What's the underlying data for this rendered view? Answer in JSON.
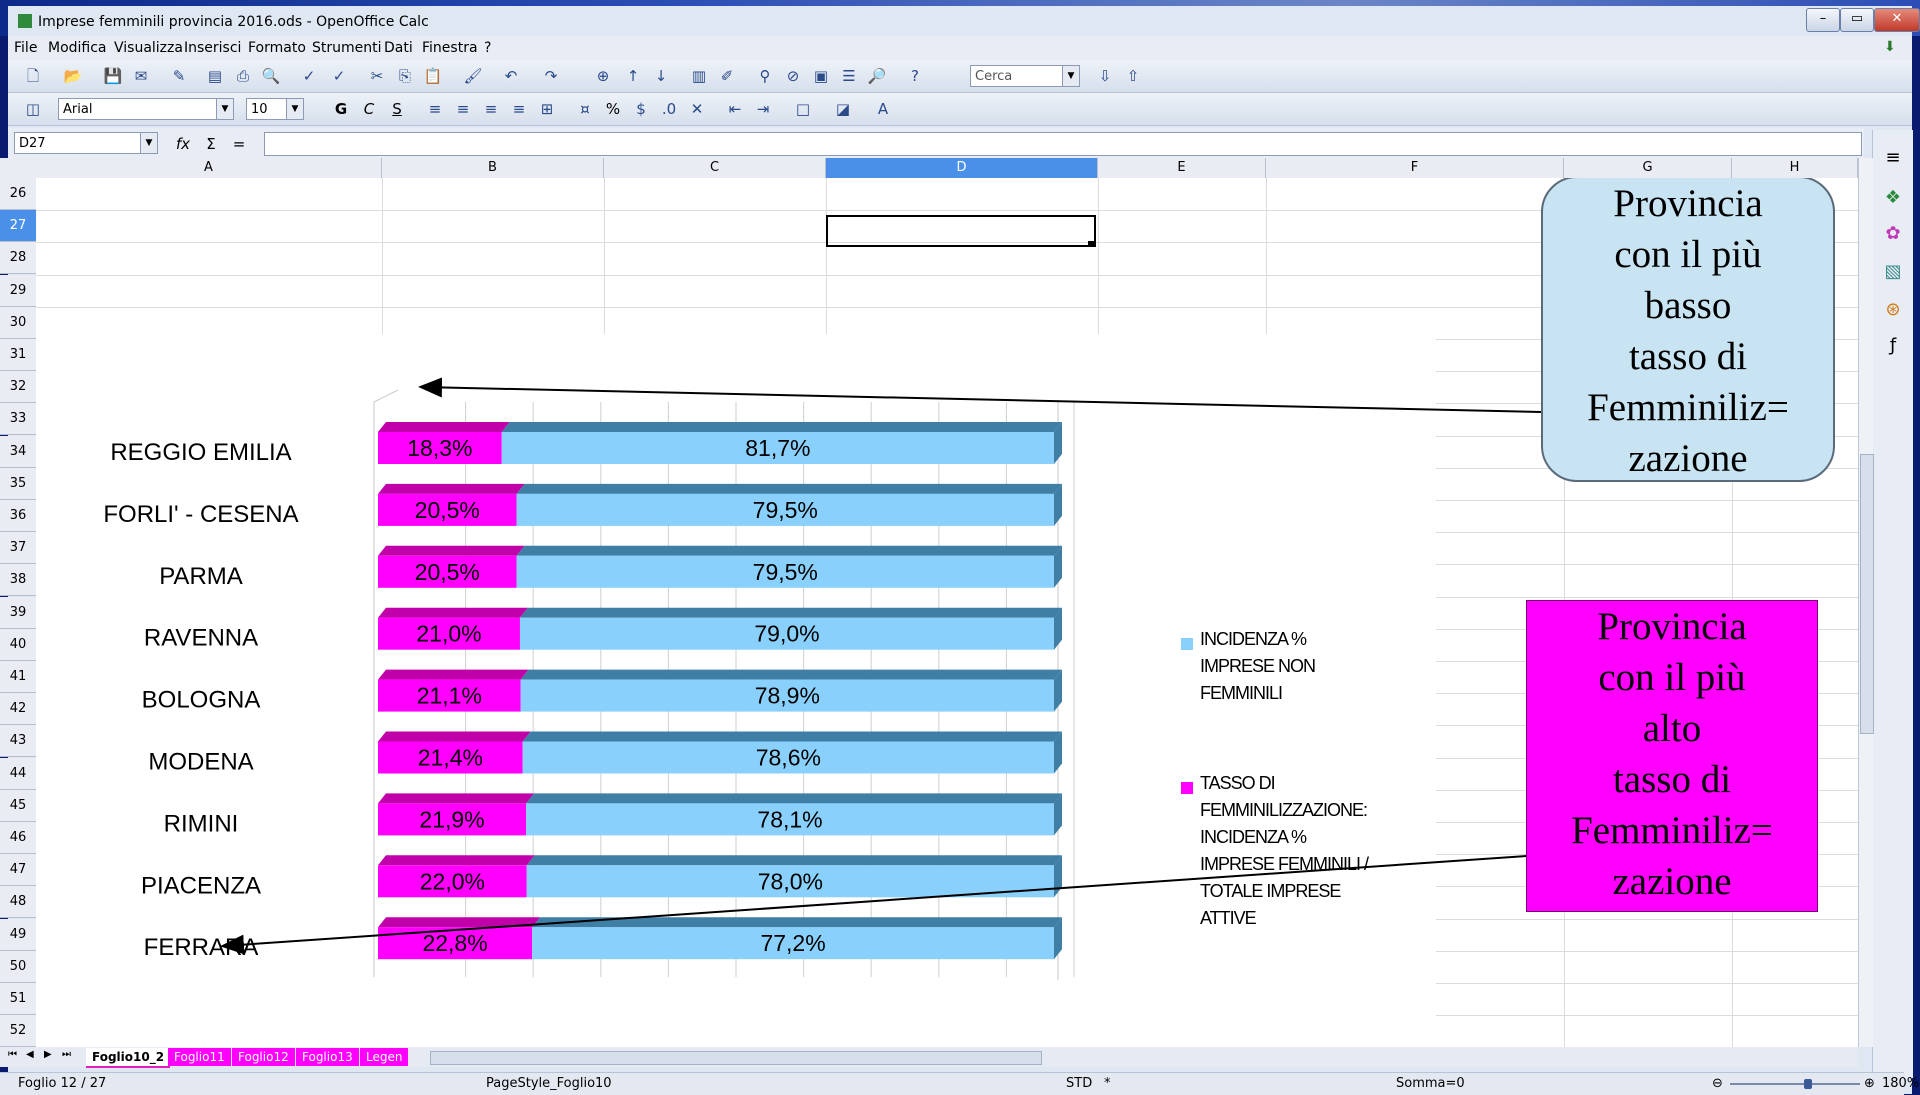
{
  "window": {
    "title": "Imprese femminili provincia 2016.ods - OpenOffice Calc",
    "buttons": {
      "minimize": "–",
      "maximize": "▭",
      "close": "✕"
    }
  },
  "menu": [
    "File",
    "Modifica",
    "Visualizza",
    "Inserisci",
    "Formato",
    "Strumenti",
    "Dati",
    "Finestra",
    "?"
  ],
  "toolbar": {
    "search_placeholder": "Cerca",
    "font_name": "Arial",
    "font_size": "10",
    "bold": "G",
    "italic": "C",
    "underline": "S",
    "percent": "%"
  },
  "formula_bar": {
    "cell_ref": "D27",
    "formula": "",
    "fx": "fx",
    "sum": "Σ",
    "equals": "="
  },
  "columns": [
    "A",
    "B",
    "C",
    "D",
    "E",
    "F",
    "G",
    "H"
  ],
  "rows": [
    "26",
    "27",
    "28",
    "29",
    "30",
    "31",
    "32",
    "33",
    "34",
    "35",
    "36",
    "37",
    "38",
    "39",
    "40",
    "41",
    "42",
    "43",
    "44",
    "45",
    "46",
    "47",
    "48",
    "49",
    "50",
    "51",
    "52"
  ],
  "chart_data": {
    "type": "bar",
    "orientation": "horizontal-stacked-percent",
    "categories": [
      "REGGIO EMILIA",
      "FORLI' - CESENA",
      "PARMA",
      "RAVENNA",
      "BOLOGNA",
      "MODENA",
      "RIMINI",
      "PIACENZA",
      "FERRARA"
    ],
    "series": [
      {
        "name": "TASSO DI FEMMINILIZZAZIONE: INCIDENZA % IMPRESE FEMMINILI / TOTALE IMPRESE ATTIVE",
        "color": "#ff00ff",
        "values": [
          18.3,
          20.5,
          20.5,
          21.0,
          21.1,
          21.4,
          21.9,
          22.0,
          22.8
        ],
        "labels": [
          "18,3%",
          "20,5%",
          "20,5%",
          "21,0%",
          "21,1%",
          "21,4%",
          "21,9%",
          "22,0%",
          "22,8%"
        ]
      },
      {
        "name": "INCIDENZA % IMPRESE NON FEMMINILI",
        "color": "#89d0fc",
        "values": [
          81.7,
          79.5,
          79.5,
          79.0,
          78.9,
          78.6,
          78.1,
          78.0,
          77.2
        ],
        "labels": [
          "81,7%",
          "79,5%",
          "79,5%",
          "79,0%",
          "78,9%",
          "78,6%",
          "78,1%",
          "78,0%",
          "77,2%"
        ]
      }
    ],
    "x_ticks": [
      "0%",
      "10%",
      "20%",
      "30%",
      "40%",
      "50%",
      "60%",
      "70%",
      "80%",
      "90%",
      "100%"
    ],
    "xlim": [
      0,
      100
    ],
    "legend_position": "right",
    "legend": {
      "item1_lines": [
        "INCIDENZA %",
        "IMPRESE NON",
        "FEMMINILI"
      ],
      "item2_lines": [
        "TASSO DI",
        "FEMMINILIZZAZIONE:",
        "INCIDENZA %",
        "IMPRESE FEMMINILI /",
        "TOTALE IMPRESE",
        "ATTIVE"
      ]
    }
  },
  "callouts": {
    "low": {
      "lines": [
        "Provincia",
        "con il più",
        "basso",
        "tasso di",
        "Femminiliz=",
        "zazione"
      ],
      "bg": "#c8e3f2"
    },
    "high": {
      "lines": [
        "Provincia",
        "con il più",
        "alto",
        "tasso di",
        "Femminiliz=",
        "zazione"
      ],
      "bg": "#ff00ff"
    }
  },
  "sheet_tabs": [
    "Foglio10_2",
    "Foglio11",
    "Foglio12",
    "Foglio13",
    "Legen"
  ],
  "status": {
    "sheet": "Foglio 12 / 27",
    "page_style": "PageStyle_Foglio10",
    "mode": "STD",
    "modified": "*",
    "sum": "Somma=0",
    "zoom": "180%"
  }
}
